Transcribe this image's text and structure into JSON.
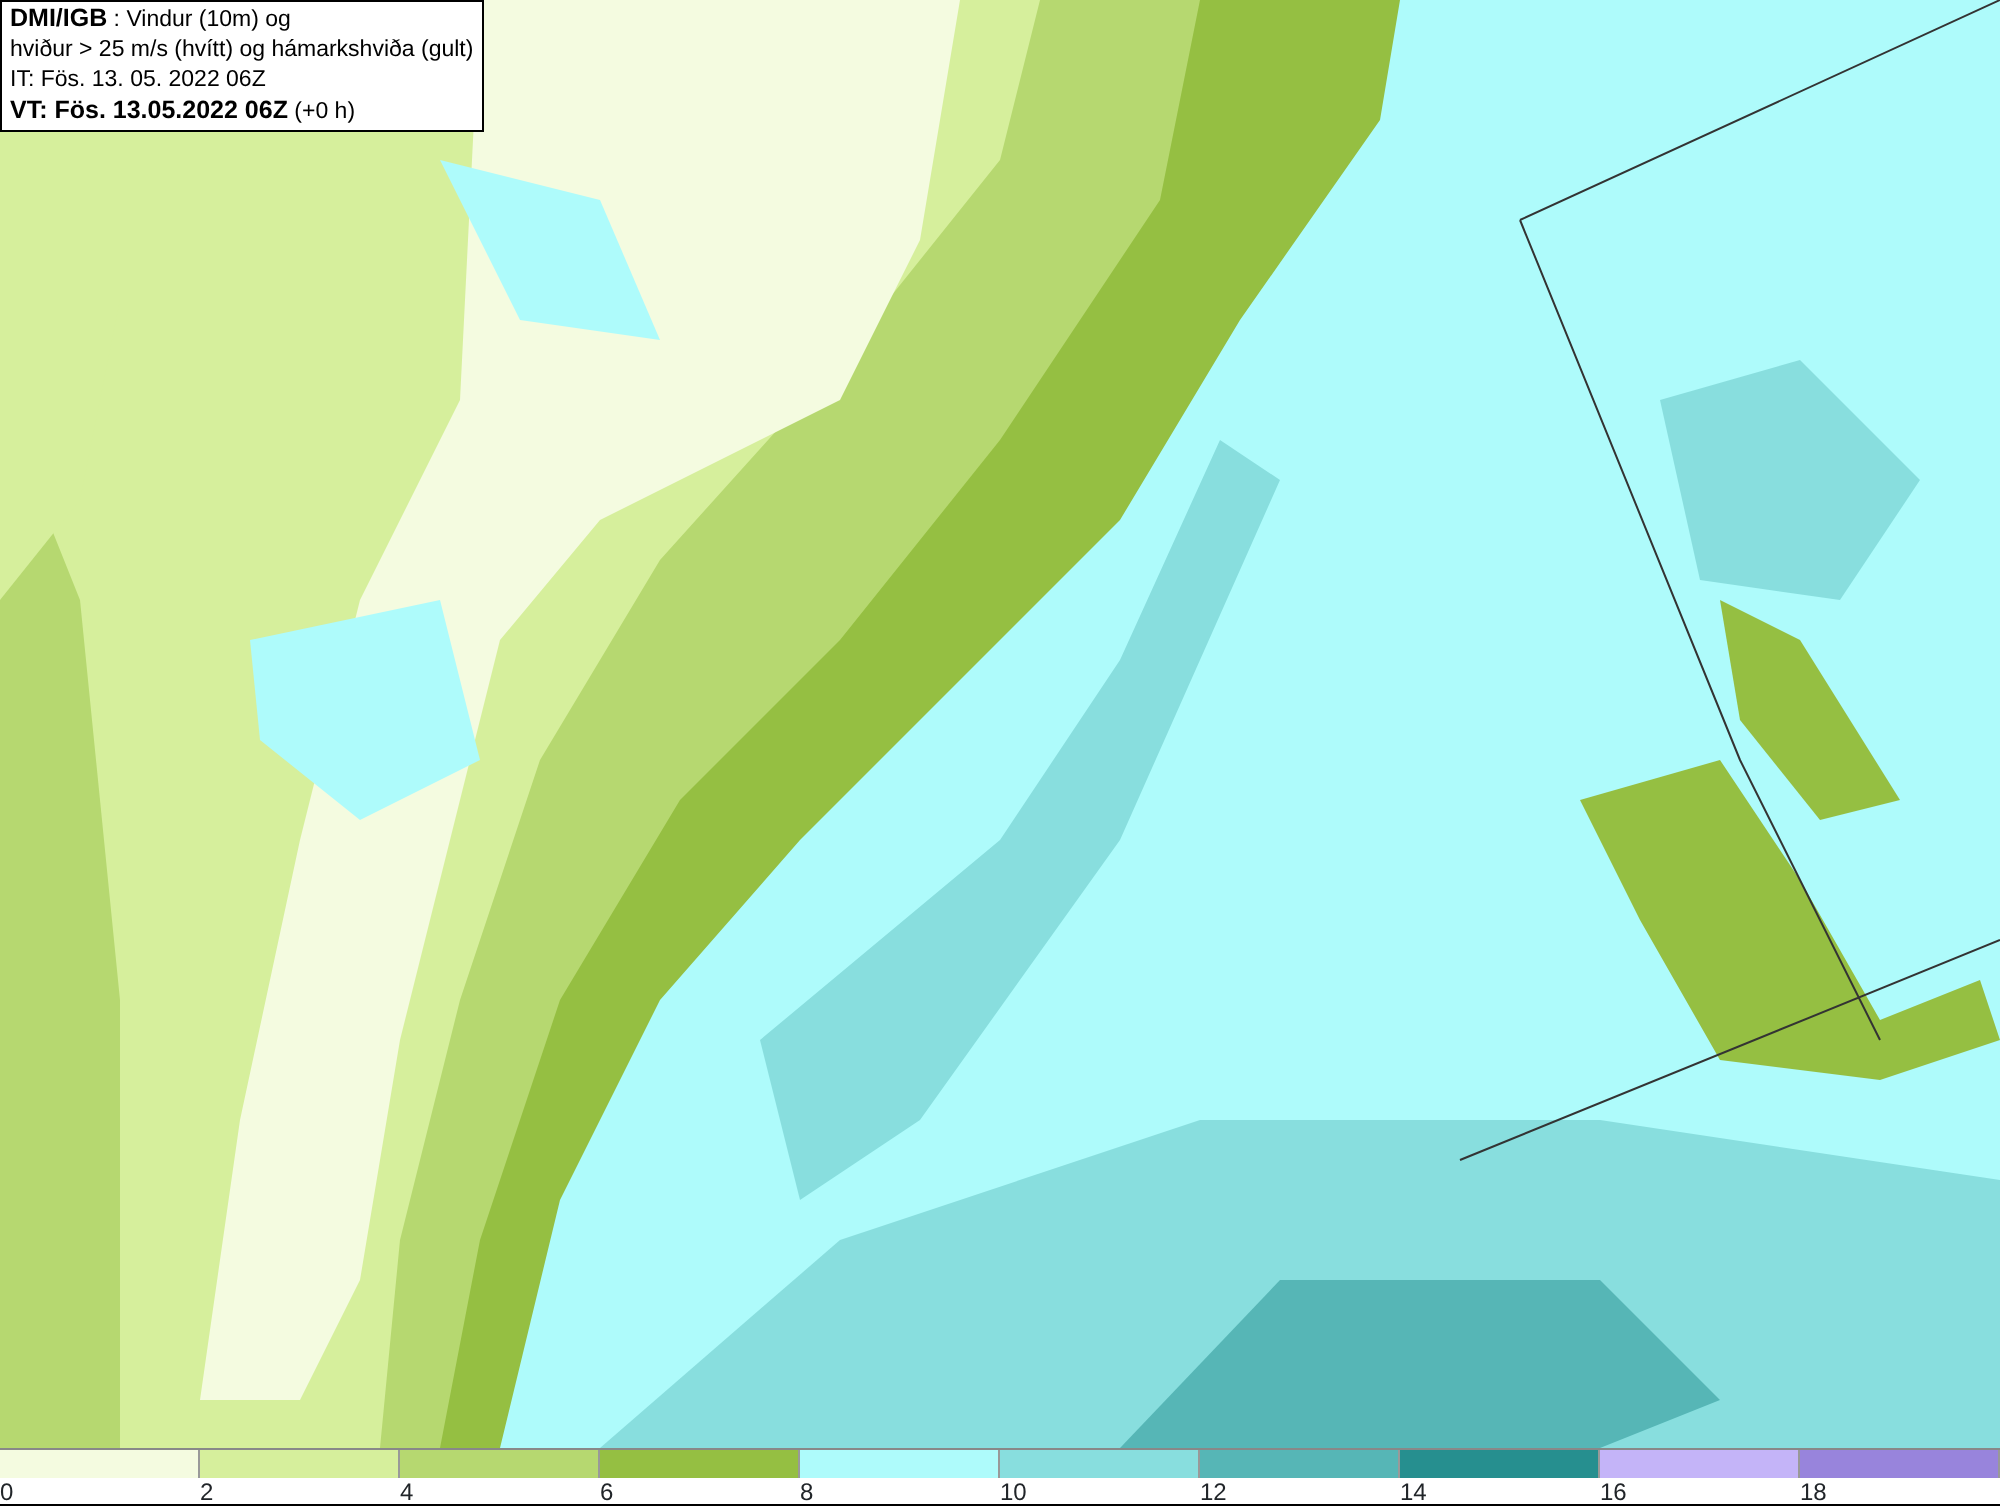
{
  "title_box": {
    "lines": [
      "**DMI/IGB** : Vindur (10m) og",
      "hviður > 25 m/s (hvítt) og hámarkshviða (gult)",
      "IT: Fös. 13. 05. 2022 06Z",
      "**VT: Fös. 13.05.2022 06Z** (+0 h)"
    ]
  },
  "legend": [
    {
      "label": "0",
      "color": "#f4fbe0"
    },
    {
      "label": "2",
      "color": "#d6ef9c"
    },
    {
      "label": "4",
      "color": "#b6d870"
    },
    {
      "label": "6",
      "color": "#95bf42"
    },
    {
      "label": "8",
      "color": "#aefbfb"
    },
    {
      "label": "10",
      "color": "#88dede"
    },
    {
      "label": "12",
      "color": "#56b6b6"
    },
    {
      "label": "14",
      "color": "#268f8f"
    },
    {
      "label": "16",
      "color": "#c4b4f8"
    },
    {
      "label": "18",
      "color": "#9884dc"
    }
  ]
}
